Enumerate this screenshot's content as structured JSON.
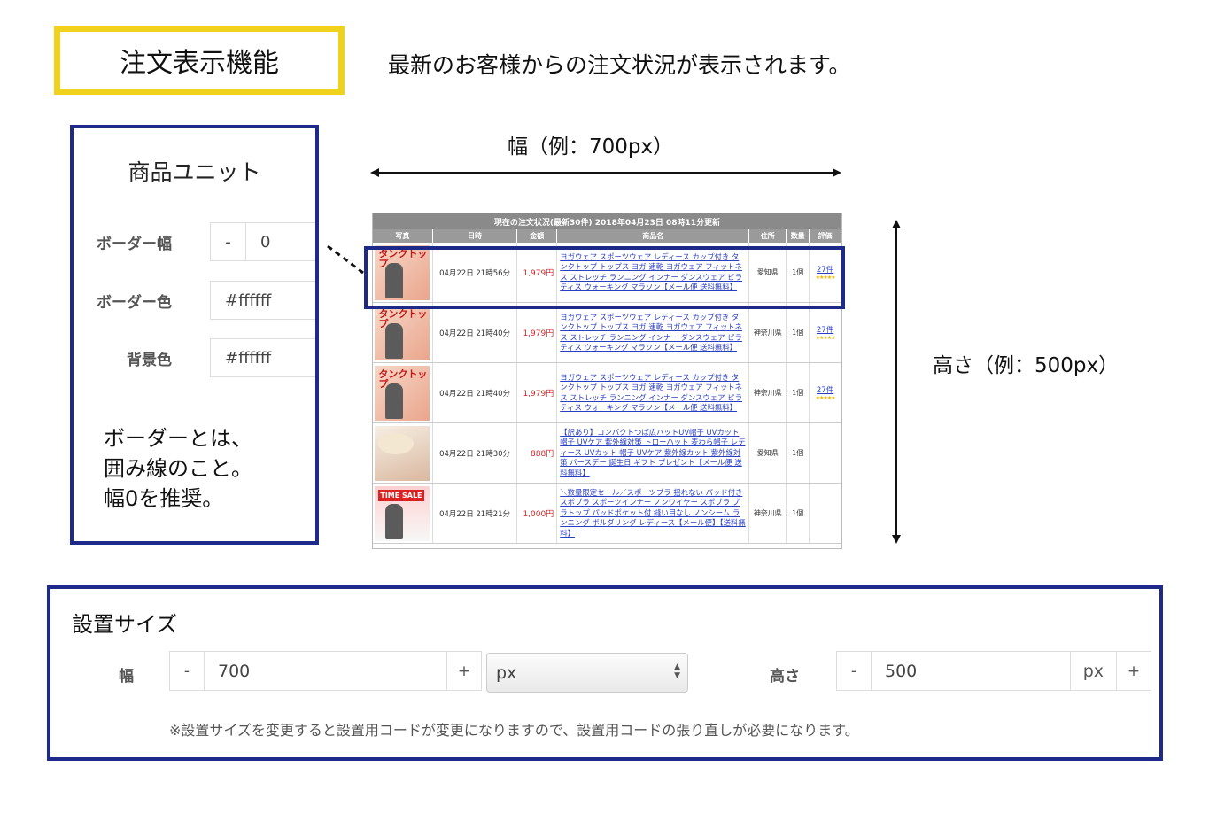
{
  "title": "注文表示機能",
  "description": "最新のお客様からの注文状況が表示されます。",
  "unit_panel": {
    "title": "商品ユニット",
    "border_width_label": "ボーダー幅",
    "border_width_minus": "-",
    "border_width_value": "0",
    "border_color_label": "ボーダー色",
    "border_color_value": "#ffffff",
    "bg_color_label": "背景色",
    "bg_color_value": "#ffffff",
    "note_line1": "ボーダーとは、",
    "note_line2": "囲み線のこと。",
    "note_line3": "幅0を推奨。"
  },
  "dimensions": {
    "width_label": "幅（例：700px）",
    "height_label": "高さ（例：500px）"
  },
  "order_widget": {
    "header": "現在の注文状況(最新30件) 2018年04月23日 08時11分更新",
    "columns": [
      "写真",
      "日時",
      "金額",
      "商品名",
      "住所",
      "数量",
      "評価"
    ],
    "rows": [
      {
        "date": "04月22日 21時56分",
        "price": "1,979円",
        "name": "ヨガウェア スポーツウェア レディース カップ付き タンクトップ トップス ヨガ 速乾 ヨガウェア フィットネス ストレッチ ランニング インナー ダンスウェア ピラティス ウォーキング マラソン【メール便 送料無料】",
        "address": "愛知県",
        "qty": "1個",
        "reviews": "27件",
        "stars": "★★★★★",
        "thumb": "tank",
        "thumb_text": "タンクトップ"
      },
      {
        "date": "04月22日 21時40分",
        "price": "1,979円",
        "name": "ヨガウェア スポーツウェア レディース カップ付き タンクトップ トップス ヨガ 速乾 ヨガウェア フィットネス ストレッチ ランニング インナー ダンスウェア ピラティス ウォーキング マラソン【メール便 送料無料】",
        "address": "神奈川県",
        "qty": "1個",
        "reviews": "27件",
        "stars": "★★★★★",
        "thumb": "tank",
        "thumb_text": "タンクトップ"
      },
      {
        "date": "04月22日 21時40分",
        "price": "1,979円",
        "name": "ヨガウェア スポーツウェア レディース カップ付き タンクトップ トップス ヨガ 速乾 ヨガウェア フィットネス ストレッチ ランニング インナー ダンスウェア ピラティス ウォーキング マラソン【メール便 送料無料】",
        "address": "神奈川県",
        "qty": "1個",
        "reviews": "27件",
        "stars": "★★★★★",
        "thumb": "tank",
        "thumb_text": "タンクトップ"
      },
      {
        "date": "04月22日 21時30分",
        "price": "888円",
        "name": "【訳あり】コンパクトつば広ハットUV帽子 UVカット帽子 UVケア 紫外線対策 トローハット 麦わら帽子 レディース UVカット 帽子 UVケア 紫外線カット 紫外線対策 バースデー 誕生日 ギフト プレゼント【メール便 送料無料】",
        "address": "愛知県",
        "qty": "1個",
        "reviews": "",
        "stars": "",
        "thumb": "hat",
        "thumb_text": ""
      },
      {
        "date": "04月22日 21時21分",
        "price": "1,000円",
        "name": "＼数量限定セール／スポーツブラ 揺れない パッド付き スポブラ スポーツインナー ノンワイヤー スポブラ ブラトップ パッドポケット付 縫い目なし ノンシーム ランニング ボルダリング レディース【メール便】【送料無料】",
        "address": "神奈川県",
        "qty": "1個",
        "reviews": "",
        "stars": "",
        "thumb": "sale",
        "thumb_text": "TIME SALE"
      }
    ]
  },
  "size_panel": {
    "title": "設置サイズ",
    "width_label": "幅",
    "minus": "-",
    "plus": "+",
    "width_value": "700",
    "unit_select_value": "px",
    "height_label": "高さ",
    "height_value": "500",
    "height_unit": "px",
    "note": "※設置サイズを変更すると設置用コードが変更になりますので、設置用コードの張り直しが必要になります。"
  },
  "colors": {
    "title_border": "#f0d21c",
    "panel_border": "#1d2a8a",
    "price_red": "#d9262c",
    "link_blue": "#2a3fc4"
  }
}
